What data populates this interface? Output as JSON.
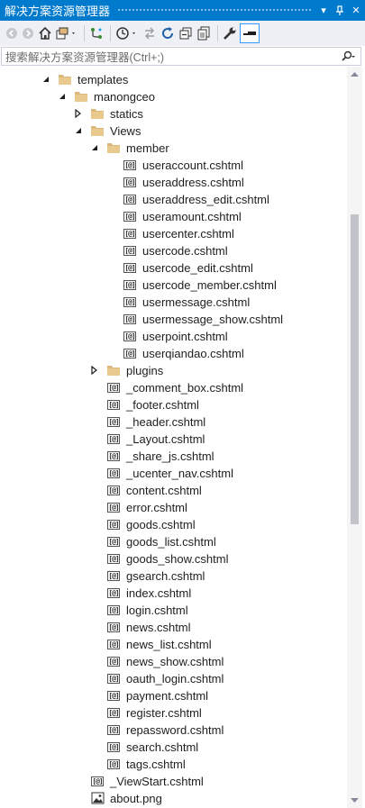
{
  "window": {
    "title": "解决方案资源管理器",
    "pin_glyph": "▾",
    "autohide_glyph": "ᛘ",
    "close_glyph": "✕"
  },
  "search": {
    "placeholder": "搜索解决方案资源管理器(Ctrl+;)"
  },
  "colors": {
    "titlebar": "#007acc",
    "folder": "#dcb67a",
    "toolbar_bg": "#eef0f5"
  },
  "toolbar": {
    "icons": [
      "back-icon",
      "forward-icon",
      "home-icon",
      "switch-views-icon",
      "pending-changes-icon",
      "history-icon",
      "sync-icon",
      "refresh-icon",
      "collapse-all-icon",
      "show-all-files-icon",
      "properties-icon",
      "preview-icon"
    ]
  },
  "tree": {
    "items": [
      {
        "label": "templates",
        "type": "folder",
        "expanded": true
      },
      {
        "label": "manongceo",
        "type": "folder",
        "expanded": true
      },
      {
        "label": "statics",
        "type": "folder",
        "expanded": false
      },
      {
        "label": "Views",
        "type": "folder",
        "expanded": true
      },
      {
        "label": "member",
        "type": "folder",
        "expanded": true
      },
      {
        "label": "useraccount.cshtml",
        "type": "razor"
      },
      {
        "label": "useraddress.cshtml",
        "type": "razor"
      },
      {
        "label": "useraddress_edit.cshtml",
        "type": "razor"
      },
      {
        "label": "useramount.cshtml",
        "type": "razor"
      },
      {
        "label": "usercenter.cshtml",
        "type": "razor"
      },
      {
        "label": "usercode.cshtml",
        "type": "razor"
      },
      {
        "label": "usercode_edit.cshtml",
        "type": "razor"
      },
      {
        "label": "usercode_member.cshtml",
        "type": "razor"
      },
      {
        "label": "usermessage.cshtml",
        "type": "razor"
      },
      {
        "label": "usermessage_show.cshtml",
        "type": "razor"
      },
      {
        "label": "userpoint.cshtml",
        "type": "razor"
      },
      {
        "label": "userqiandao.cshtml",
        "type": "razor"
      },
      {
        "label": "plugins",
        "type": "folder",
        "expanded": false
      },
      {
        "label": "_comment_box.cshtml",
        "type": "razor"
      },
      {
        "label": "_footer.cshtml",
        "type": "razor"
      },
      {
        "label": "_header.cshtml",
        "type": "razor"
      },
      {
        "label": "_Layout.cshtml",
        "type": "razor"
      },
      {
        "label": "_share_js.cshtml",
        "type": "razor"
      },
      {
        "label": "_ucenter_nav.cshtml",
        "type": "razor"
      },
      {
        "label": "content.cshtml",
        "type": "razor"
      },
      {
        "label": "error.cshtml",
        "type": "razor"
      },
      {
        "label": "goods.cshtml",
        "type": "razor"
      },
      {
        "label": "goods_list.cshtml",
        "type": "razor"
      },
      {
        "label": "goods_show.cshtml",
        "type": "razor"
      },
      {
        "label": "gsearch.cshtml",
        "type": "razor"
      },
      {
        "label": "index.cshtml",
        "type": "razor"
      },
      {
        "label": "login.cshtml",
        "type": "razor"
      },
      {
        "label": "news.cshtml",
        "type": "razor"
      },
      {
        "label": "news_list.cshtml",
        "type": "razor"
      },
      {
        "label": "news_show.cshtml",
        "type": "razor"
      },
      {
        "label": "oauth_login.cshtml",
        "type": "razor"
      },
      {
        "label": "payment.cshtml",
        "type": "razor"
      },
      {
        "label": "register.cshtml",
        "type": "razor"
      },
      {
        "label": "repassword.cshtml",
        "type": "razor"
      },
      {
        "label": "search.cshtml",
        "type": "razor"
      },
      {
        "label": "tags.cshtml",
        "type": "razor"
      },
      {
        "label": "_ViewStart.cshtml",
        "type": "razor"
      },
      {
        "label": "about.png",
        "type": "image"
      }
    ]
  }
}
